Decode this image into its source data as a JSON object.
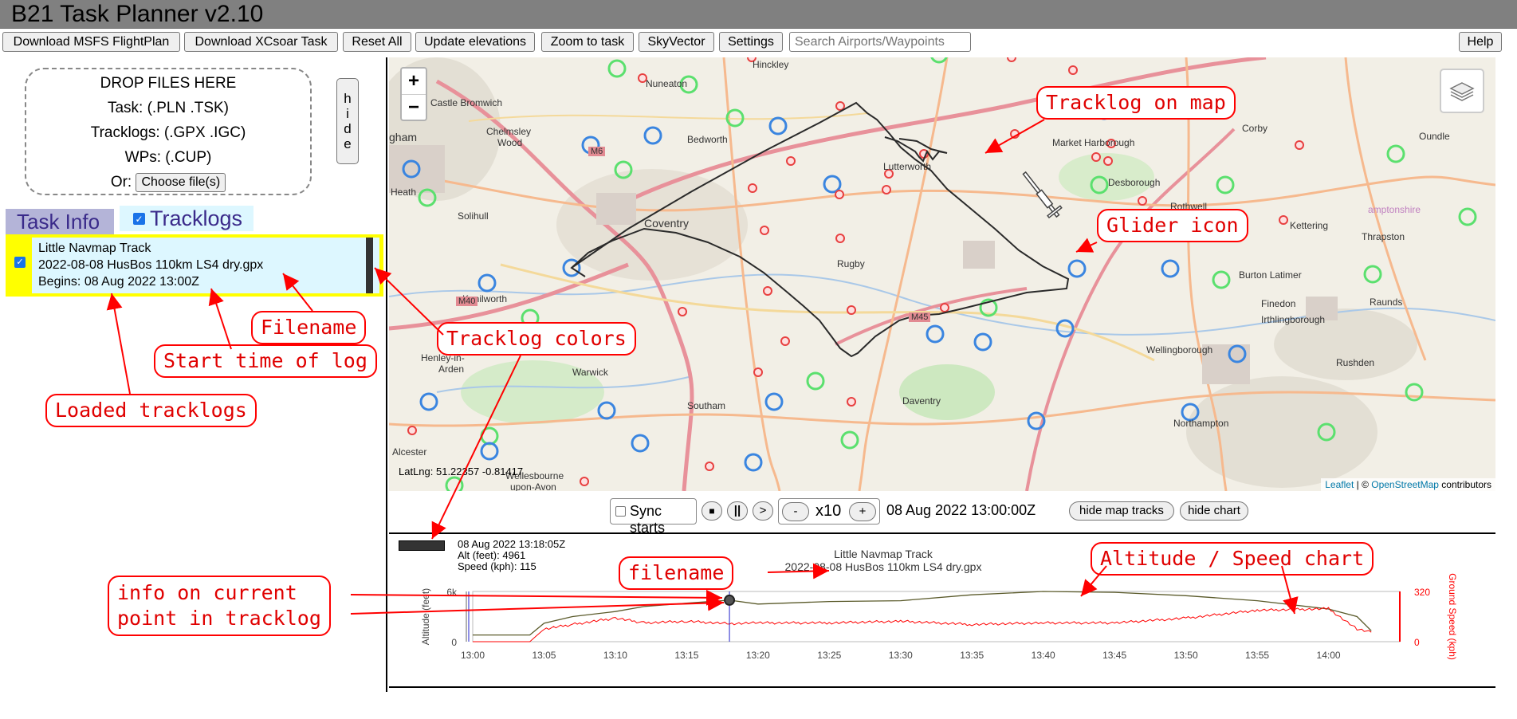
{
  "app": {
    "title": "B21 Task Planner v2.10"
  },
  "toolbar": {
    "download_msfs": "Download MSFS FlightPlan",
    "download_xcsoar": "Download XCsoar Task",
    "reset_all": "Reset All",
    "update_elevations": "Update elevations",
    "zoom_to_task": "Zoom to task",
    "skyvector": "SkyVector",
    "settings": "Settings",
    "search_placeholder": "Search Airports/Waypoints",
    "help": "Help"
  },
  "dropzone": {
    "heading": "DROP FILES HERE",
    "task": "Task: (.PLN .TSK)",
    "tracklogs": "Tracklogs: (.GPX .IGC)",
    "wps": "WPs: (.CUP)",
    "or": "Or:",
    "choose": "Choose file(s)",
    "hide": "hide"
  },
  "tabs": {
    "task_info": "Task Info",
    "tracklogs": "Tracklogs"
  },
  "tracklog": {
    "name": "Little Navmap Track",
    "filename": "2022-08-08 HusBos 110km LS4 dry.gpx",
    "begins": "Begins: 08 Aug 2022 13:00Z"
  },
  "map": {
    "latlng": "LatLng: 51.22357 -0.81417",
    "attribution_leaflet": "Leaflet",
    "attribution_sep": " | © ",
    "attribution_osm": "OpenStreetMap",
    "attribution_rest": " contributors",
    "zoom_in": "+",
    "zoom_out": "−",
    "places": [
      {
        "name": "Hinckley"
      },
      {
        "name": "Nuneaton"
      },
      {
        "name": "Castle Bromwich"
      },
      {
        "name": "Chelmsley"
      },
      {
        "name": "Wood"
      },
      {
        "name": "gham"
      },
      {
        "name": "Bedworth"
      },
      {
        "name": "Lutterworth"
      },
      {
        "name": "Market Harborough"
      },
      {
        "name": "Corby"
      },
      {
        "name": "Oundle"
      },
      {
        "name": "Solihull"
      },
      {
        "name": "Coventry"
      },
      {
        "name": "Rugby"
      },
      {
        "name": "Desborough"
      },
      {
        "name": "Rothwell"
      },
      {
        "name": "Thrapston"
      },
      {
        "name": "Kettering"
      },
      {
        "name": "Burton Latimer"
      },
      {
        "name": "Kenilworth"
      },
      {
        "name": "Finedon"
      },
      {
        "name": "Irthlingborough"
      },
      {
        "name": "Raunds"
      },
      {
        "name": "Wellingborough"
      },
      {
        "name": "Rushden"
      },
      {
        "name": "Henley-in-"
      },
      {
        "name": "Arden"
      },
      {
        "name": "Warwick"
      },
      {
        "name": "Southam"
      },
      {
        "name": "Daventry"
      },
      {
        "name": "Northampton"
      },
      {
        "name": "Alcester"
      },
      {
        "name": "Wellesbourne"
      },
      {
        "name": "upon-Avon"
      },
      {
        "name": "M6"
      },
      {
        "name": "M40"
      },
      {
        "name": "M45"
      },
      {
        "name": "Heath"
      },
      {
        "name": "amptonshire"
      }
    ]
  },
  "playback": {
    "sync_starts": "Sync starts",
    "stop": "■",
    "pause": "||",
    "play": ">",
    "minus": "-",
    "speed": "x10",
    "plus": "+",
    "time": "08 Aug 2022 13:00:00Z",
    "hide_map_tracks": "hide map tracks",
    "hide_chart": "hide chart"
  },
  "current_point": {
    "time": "08 Aug 2022 13:18:05Z",
    "alt": "Alt (feet): 4961",
    "speed": "Speed (kph): 115"
  },
  "chart": {
    "title": "Little Navmap Track",
    "subtitle": "2022-08-08 HusBos 110km LS4 dry.gpx",
    "y_left_label": "Altitude (feet)",
    "y_right_label": "Ground Speed (kph)",
    "y_left_ticks": [
      "6k",
      "0"
    ],
    "y_right_ticks": [
      "320",
      "0"
    ],
    "x_ticks": [
      "13:00",
      "13:05",
      "13:10",
      "13:15",
      "13:20",
      "13:25",
      "13:30",
      "13:35",
      "13:40",
      "13:45",
      "13:50",
      "13:55",
      "14:00"
    ],
    "colors": {
      "altitude": "#5a5a2a",
      "speed": "#ff0000",
      "cursor": "#2222cc"
    }
  },
  "chart_data": {
    "type": "line",
    "x": [
      "13:00",
      "13:04",
      "13:05",
      "13:07",
      "13:10",
      "13:12",
      "13:15",
      "13:18",
      "13:20",
      "13:25",
      "13:30",
      "13:35",
      "13:40",
      "13:45",
      "13:50",
      "13:55",
      "14:00",
      "14:02",
      "14:03"
    ],
    "series": [
      {
        "name": "Altitude (feet)",
        "axis": "left",
        "values": [
          800,
          800,
          2200,
          3000,
          3600,
          4200,
          4600,
          4961,
          4500,
          4800,
          4900,
          5600,
          6000,
          5900,
          5500,
          4900,
          3900,
          3000,
          1300
        ]
      },
      {
        "name": "Ground Speed (kph)",
        "axis": "right",
        "values": [
          0,
          0,
          80,
          110,
          150,
          120,
          130,
          115,
          120,
          120,
          130,
          110,
          120,
          120,
          150,
          200,
          210,
          80,
          60
        ]
      }
    ],
    "y_left_lim": [
      0,
      6000
    ],
    "y_right_lim": [
      0,
      320
    ]
  },
  "annotations": {
    "tracklog_on_map": "Tracklog on map",
    "glider_icon": "Glider icon",
    "filename": "Filename",
    "tracklog_colors": "Tracklog colors",
    "start_time": "Start time of log",
    "loaded_tracklogs": "Loaded tracklogs",
    "filename_lower": "filename",
    "altitude_speed_chart": "Altitude / Speed chart",
    "info_line1": "info on current",
    "info_line2": "point in tracklog"
  },
  "icons": {
    "layers": "layers-icon",
    "glider": "glider-icon"
  }
}
